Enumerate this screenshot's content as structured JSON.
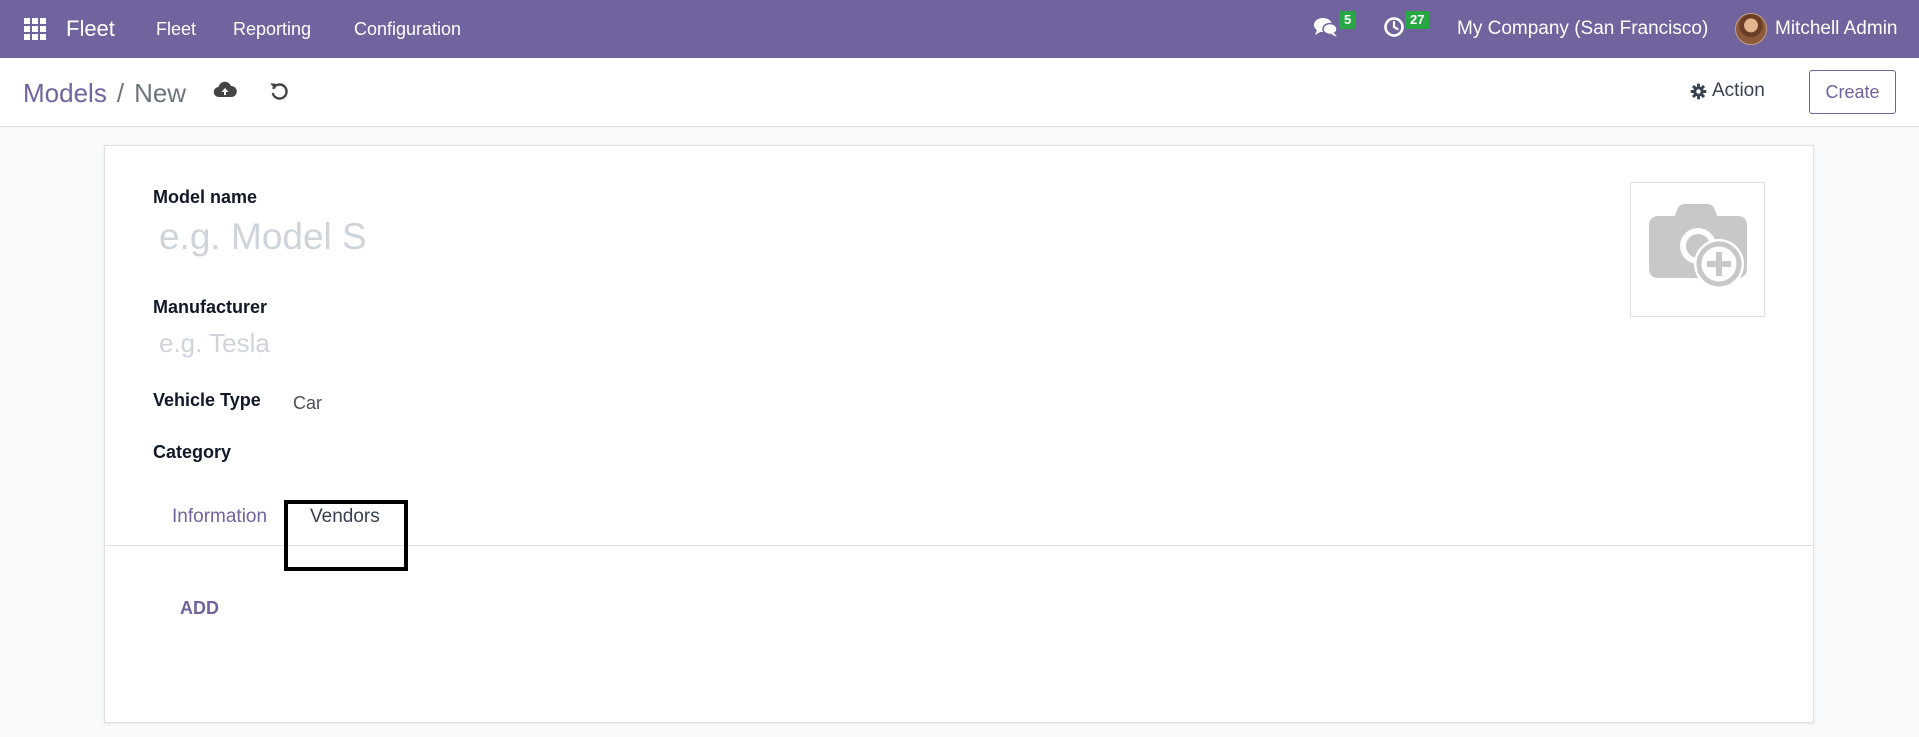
{
  "navbar": {
    "app_name": "Fleet",
    "menu": [
      "Fleet",
      "Reporting",
      "Configuration"
    ],
    "messages_count": "5",
    "activities_count": "27",
    "company": "My Company (San Francisco)",
    "user": "Mitchell Admin",
    "bg_color": "#71639e"
  },
  "breadcrumb": {
    "parent": "Models",
    "separator": "/",
    "current": "New"
  },
  "control_panel": {
    "action_label": "Action",
    "create_label": "Create"
  },
  "form": {
    "model_name_label": "Model name",
    "model_name_placeholder": "e.g. Model S",
    "manufacturer_label": "Manufacturer",
    "manufacturer_placeholder": "e.g. Tesla",
    "vehicle_type_label": "Vehicle Type",
    "vehicle_type_value": "Car",
    "category_label": "Category"
  },
  "tabs": {
    "information": "Information",
    "vendors": "Vendors"
  },
  "vendors_tab": {
    "add_label": "ADD"
  },
  "icons": {
    "apps": "apps-grid-icon",
    "messages": "chat-bubbles-icon",
    "activities": "clock-icon",
    "save": "cloud-upload-icon",
    "discard": "undo-icon",
    "action": "gear-icon",
    "image": "camera-plus-icon"
  }
}
